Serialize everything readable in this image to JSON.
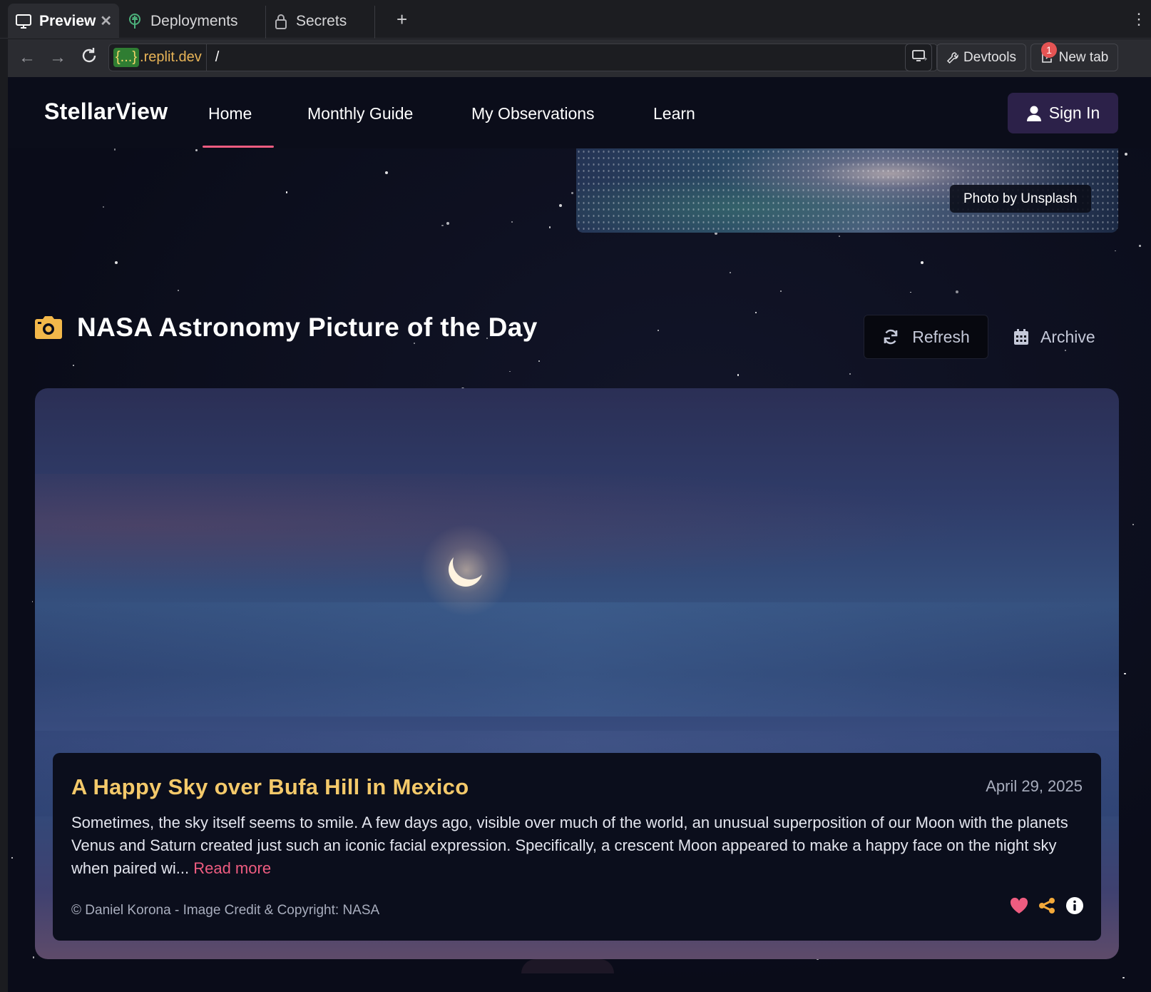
{
  "browser": {
    "tabs": [
      {
        "label": "Preview",
        "icon": "monitor-icon",
        "active": true
      },
      {
        "label": "Deployments",
        "icon": "deployments-icon",
        "active": false
      },
      {
        "label": "Secrets",
        "icon": "lock-icon",
        "active": false
      }
    ],
    "url_host_badge": "{...}",
    "url_host": ".replit.dev",
    "url_path": "/",
    "devtools_label": "Devtools",
    "devtools_badge": "1",
    "new_tab_label": "New tab"
  },
  "site": {
    "brand": "StellarView",
    "nav": [
      {
        "label": "Home",
        "active": true
      },
      {
        "label": "Monthly Guide",
        "active": false
      },
      {
        "label": "My Observations",
        "active": false
      },
      {
        "label": "Learn",
        "active": false
      }
    ],
    "sign_in_label": "Sign In",
    "photo_credit": "Photo by Unsplash"
  },
  "apod": {
    "section_title": "NASA Astronomy Picture of the Day",
    "refresh_label": "Refresh",
    "archive_label": "Archive",
    "title": "A Happy Sky over Bufa Hill in Mexico",
    "date": "April 29, 2025",
    "description": "Sometimes, the sky itself seems to smile. A few days ago, visible over much of the world, an unusual superposition of our Moon with the planets Venus and Saturn created just such an iconic facial expression. Specifically, a crescent Moon appeared to make a happy face on the night sky when paired wi...",
    "read_more": "Read more",
    "credit": "© Daniel Korona - Image Credit & Copyright: NASA"
  },
  "colors": {
    "accent_pink": "#ee5c80",
    "title_gold": "#f4c96a",
    "camera_icon": "#f3b84a",
    "share_icon": "#f3a93a",
    "signin_bg": "#2c2149"
  }
}
